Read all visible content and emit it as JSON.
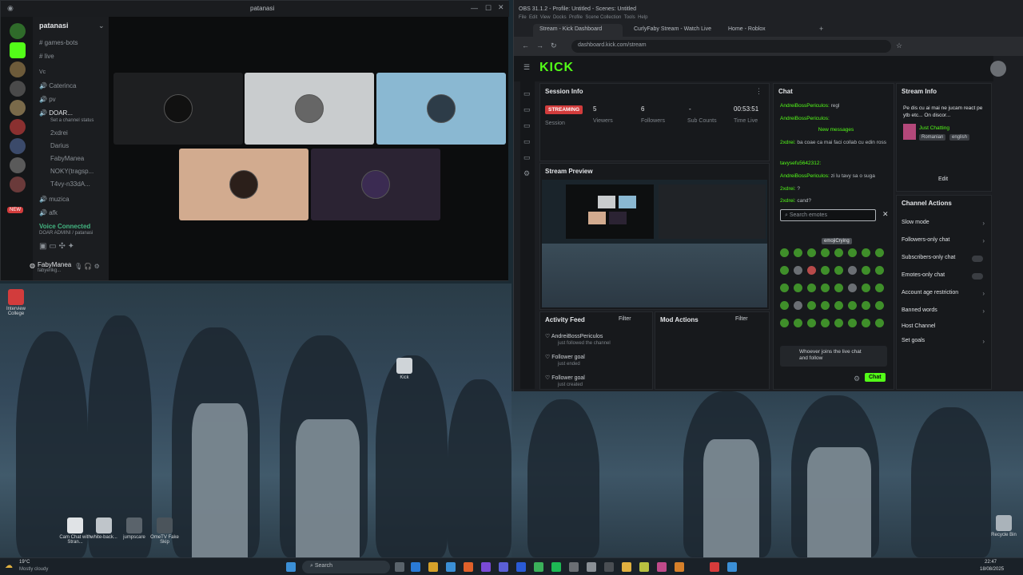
{
  "discord": {
    "window_title": "patanasi",
    "server_name": "patanasi",
    "channels": [
      "games-bots",
      "live",
      "Caterinca",
      "pv",
      "DOAR...",
      "muzica",
      "afk"
    ],
    "voice_members": [
      "2xdrei",
      "Darius",
      "FabyManea",
      "NOKY(tragsp...",
      "T4vy-n33dA..."
    ],
    "channel_status": "Set a channel status",
    "voice_status": "Voice Connected",
    "voice_sub": "DOAR ADMINI / patanasi",
    "user_name": "FabyManea",
    "user_sub": "fabyerikg...",
    "new_badge": "NEW",
    "vc_section": "Vc"
  },
  "obs": {
    "title": "OBS 31.1.2 - Profile: Untitled - Scenes: Untitled",
    "menu": [
      "File",
      "Edit",
      "View",
      "Docks",
      "Profile",
      "Scene Collection",
      "Tools",
      "Help"
    ],
    "tabs": [
      {
        "label": "Stream - Kick Dashboard",
        "active": true
      },
      {
        "label": "CurlyFaby Stream - Watch Live",
        "active": false
      },
      {
        "label": "Home - Roblox",
        "active": false
      }
    ],
    "url": "dashboard.kick.com/stream"
  },
  "kick": {
    "logo": "KICK",
    "session": {
      "title": "Session Info",
      "badge": "STREAMING",
      "badge_label": "Session",
      "viewers_value": "5",
      "viewers_label": "Viewers",
      "followers_value": "6",
      "followers_label": "Followers",
      "subs_value": "-",
      "subs_label": "Sub Counts",
      "time_value": "00:53:51",
      "time_label": "Time Live"
    },
    "preview_title": "Stream Preview",
    "activity": {
      "title": "Activity Feed",
      "filter": "Filter",
      "items": [
        {
          "name": "AndreiBossPericulos",
          "sub": "just followed the channel",
          "time": "3 minutes ago"
        },
        {
          "name": "Follower goal",
          "sub": "just ended",
          "time": "17 minutes ago"
        },
        {
          "name": "Follower goal",
          "sub": "just created",
          "time": "17 minutes ago"
        }
      ]
    },
    "mod": {
      "title": "Mod Actions",
      "filter": "Filter"
    },
    "chat": {
      "title": "Chat",
      "messages": [
        {
          "user": "AndreiBossPericulos:",
          "text": "regl"
        },
        {
          "user": "AndreiBossPericulos:",
          "text": ""
        },
        {
          "user": "2xdrei:",
          "text": "ba coae ca mai faci collab cu edin ross"
        },
        {
          "user": "tavysefu5642312:",
          "text": ""
        },
        {
          "user": "AndreiBossPericulos:",
          "text": "zi lu tavy sa o suga"
        },
        {
          "user": "2xdrei:",
          "text": "?"
        },
        {
          "user": "2xdrei:",
          "text": "cand?"
        }
      ],
      "new_messages": "New messages",
      "search_placeholder": "Search emotes",
      "tooltip": "emojiCrying",
      "pinned": "Whoever joins the live chat and follow",
      "send": "Chat"
    },
    "stream_info": {
      "title": "Stream Info",
      "description": "Pe dis cu ai mai ne jucam react pe ytb etc... On discor...",
      "category": "Just Chatting",
      "tags": [
        "Romanian",
        "english"
      ],
      "edit": "Edit"
    },
    "channel_actions": {
      "title": "Channel Actions",
      "rows": [
        "Slow mode",
        "Followers-only chat",
        "Subscribers-only chat",
        "Emotes-only chat",
        "Account age restriction",
        "Banned words",
        "Host Channel",
        "Set goals"
      ]
    }
  },
  "desktop": {
    "icons": [
      "Interview College",
      "Kick",
      "Cam Chat with Stran...",
      "white-back...",
      "jumpscare",
      "OmeTV Fake Skip",
      "Recycle Bin"
    ],
    "weather": "19°C",
    "weather_sub": "Mostly cloudy",
    "search": "Search",
    "clock_time": "22:47",
    "clock_date": "18/08/2025"
  }
}
